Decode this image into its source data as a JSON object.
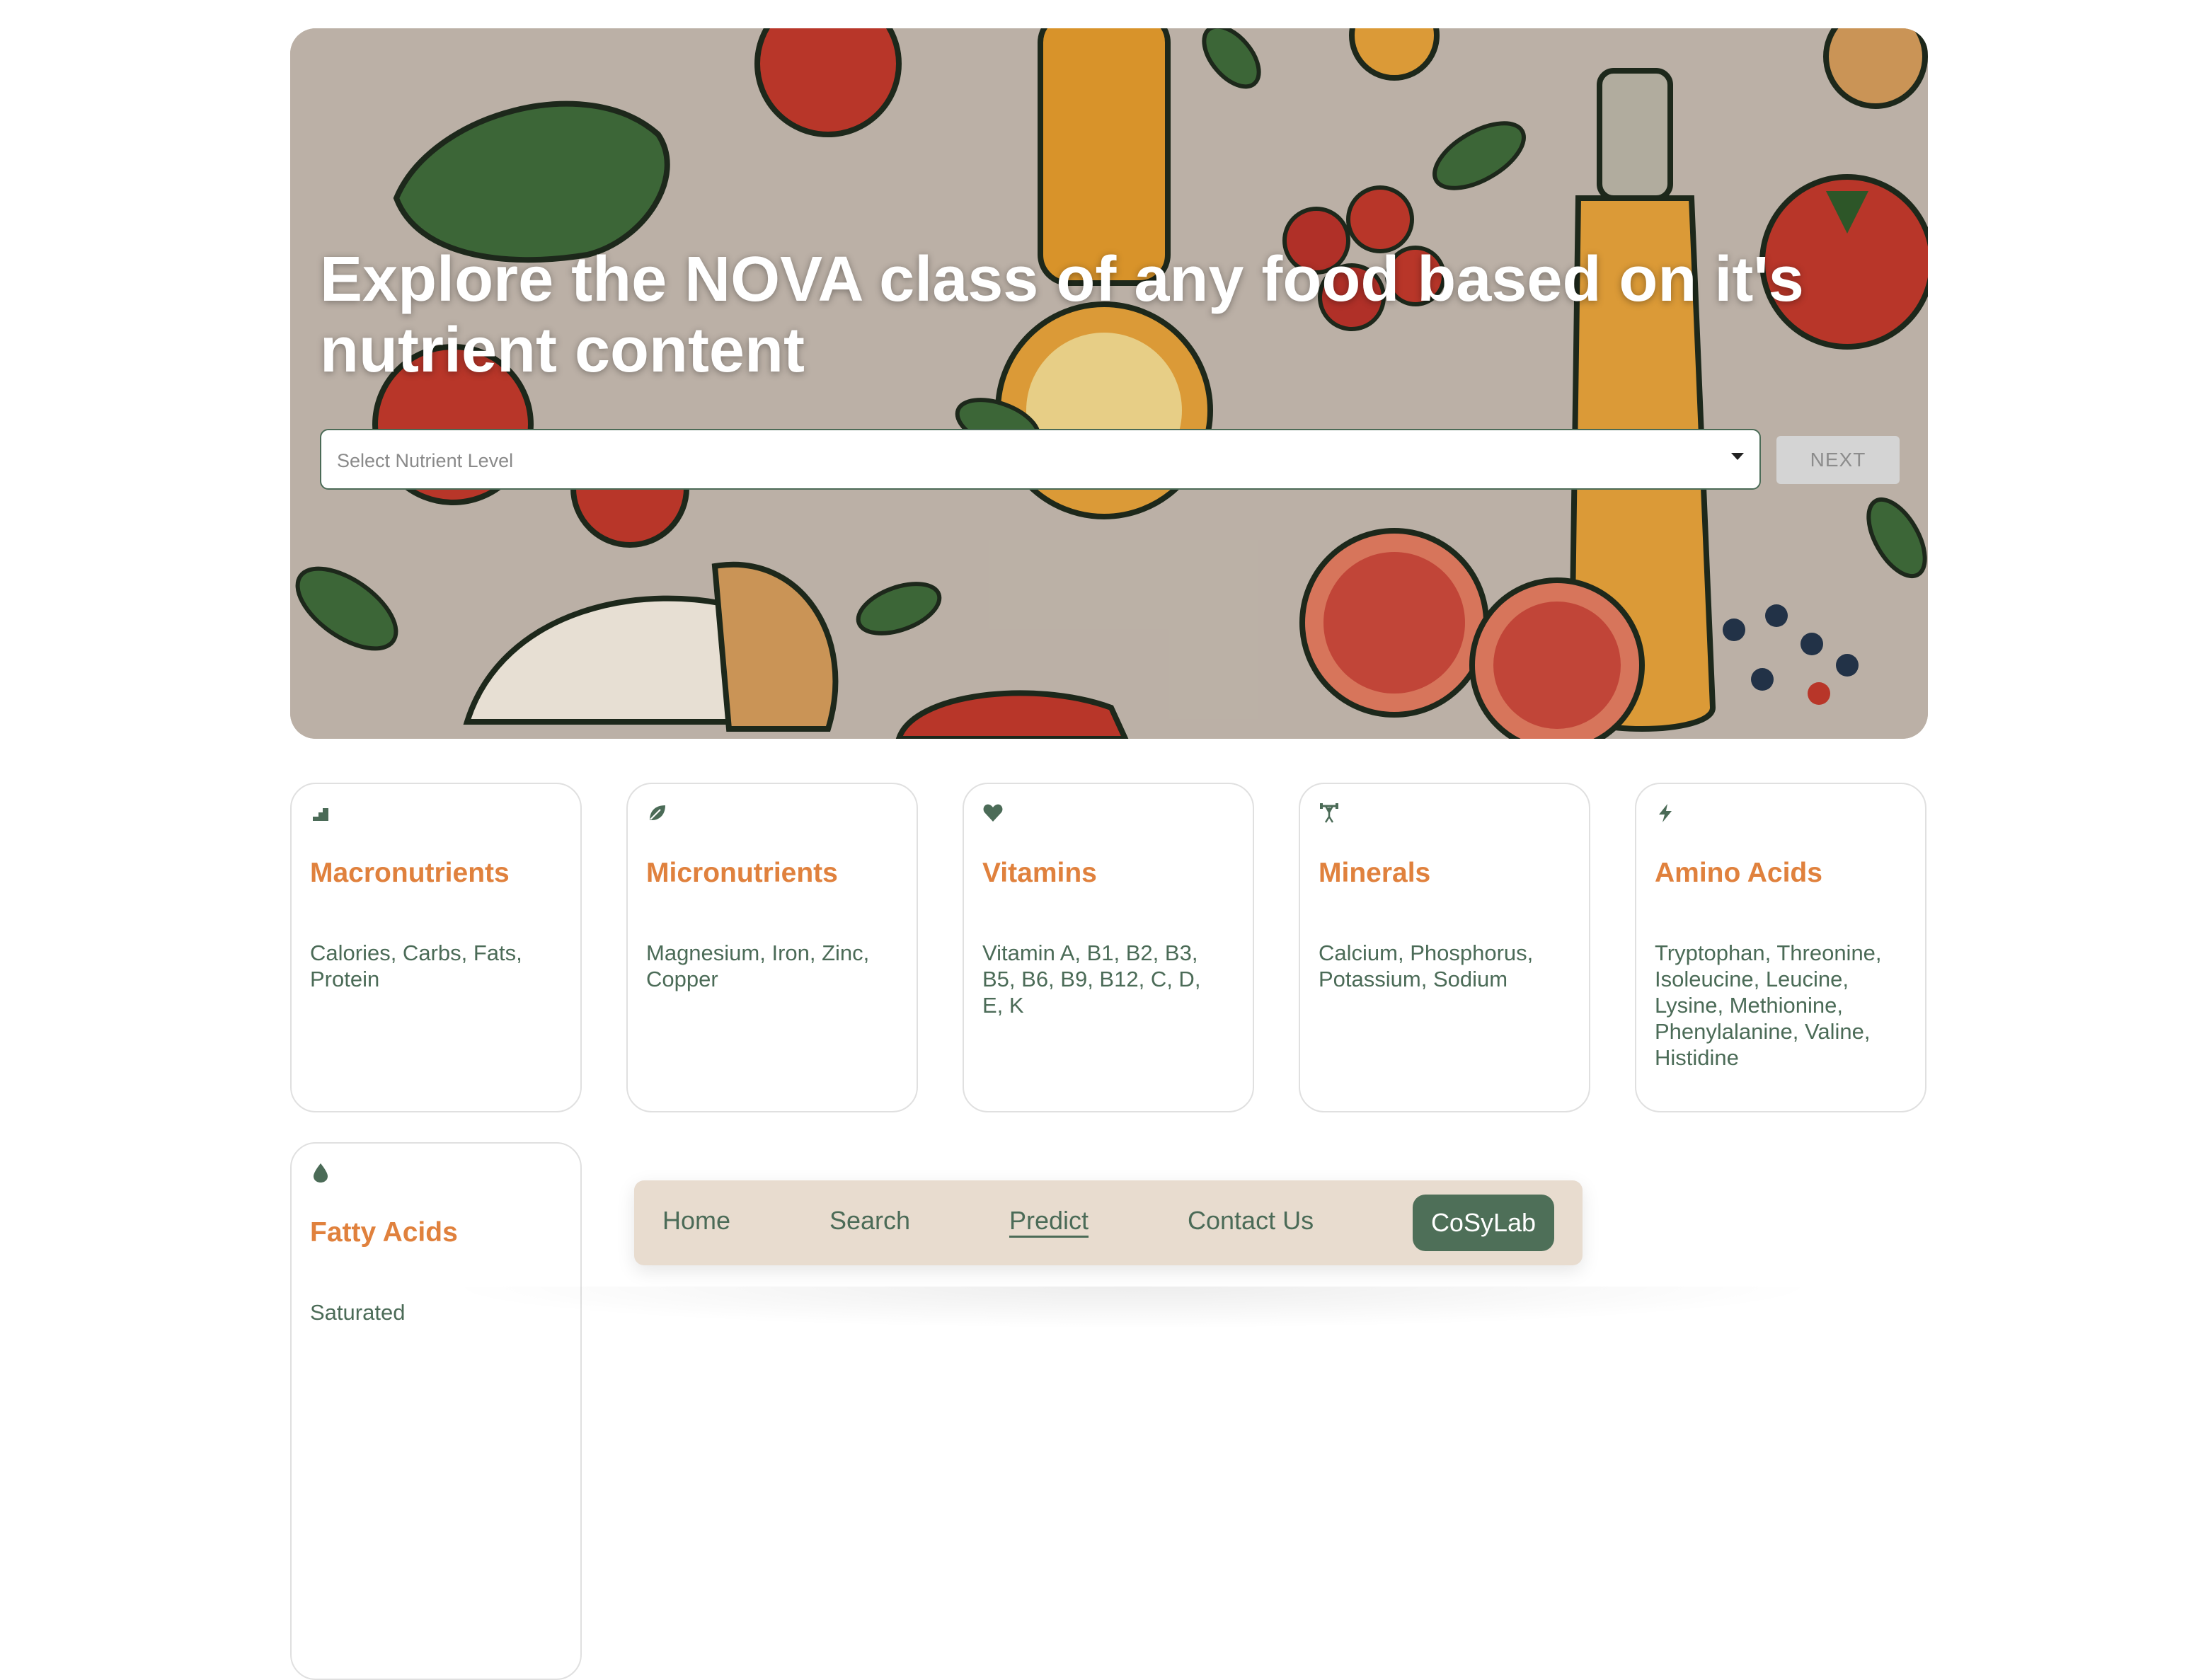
{
  "hero": {
    "title": "Explore the NOVA class of any food based on it's nutrient content",
    "select_placeholder": "Select Nutrient Level",
    "next_label": "NEXT"
  },
  "cards": [
    {
      "icon": "chart-steps-icon",
      "title": "Macronutrients",
      "desc": "Calories, Carbs, Fats, Protein"
    },
    {
      "icon": "leaf-icon",
      "title": "Micronutrients",
      "desc": "Magnesium, Iron, Zinc, Copper"
    },
    {
      "icon": "heart-icon",
      "title": "Vitamins",
      "desc": "Vitamin A, B1, B2, B3, B5, B6, B9, B12, C, D, E, K"
    },
    {
      "icon": "weightlifter-icon",
      "title": "Minerals",
      "desc": "Calcium, Phosphorus, Potassium, Sodium"
    },
    {
      "icon": "lightning-icon",
      "title": "Amino Acids",
      "desc": "Tryptophan, Threonine, Isoleucine, Leucine, Lysine, Methionine, Phenylalanine, Valine, Histidine"
    },
    {
      "icon": "drop-icon",
      "title": "Fatty Acids",
      "desc": "Saturated"
    }
  ],
  "nav": {
    "items": [
      "Home",
      "Search",
      "Predict",
      "Contact Us"
    ],
    "active": "Predict",
    "cta": "CoSyLab"
  },
  "colors": {
    "accent_orange": "#e0813d",
    "accent_green": "#4e6f58",
    "nav_bg": "#e8dccf"
  }
}
